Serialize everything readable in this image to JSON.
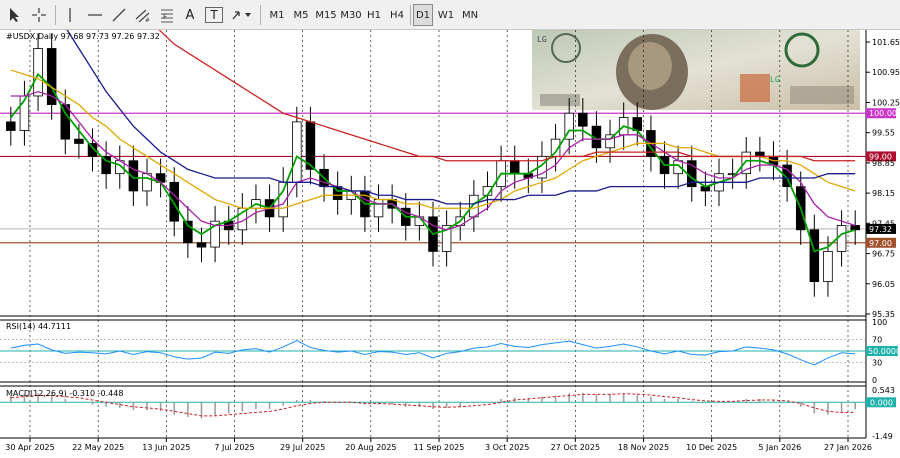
{
  "toolbar": {
    "tools": [
      {
        "name": "cursor-icon"
      },
      {
        "name": "crosshair-icon"
      },
      {
        "name": "vertical-line-icon"
      },
      {
        "name": "horizontal-line-icon"
      },
      {
        "name": "trendline-icon"
      },
      {
        "name": "equidistant-channel-icon"
      },
      {
        "name": "fibonacci-icon"
      },
      {
        "name": "text-icon",
        "label": "A"
      },
      {
        "name": "text-label-icon",
        "label": "T"
      },
      {
        "name": "arrows-icon"
      }
    ],
    "timeframes": [
      "M1",
      "M5",
      "M15",
      "M30",
      "H1",
      "H4",
      "D1",
      "W1",
      "MN"
    ],
    "active_timeframe": "D1"
  },
  "main_panel": {
    "header": "#USDX,Daily  97.68 97.73 97.26 97.32",
    "price_labels": [
      "101.65",
      "100.95",
      "100.25",
      "99.55",
      "98.85",
      "98.15",
      "97.45",
      "96.75",
      "96.05",
      "95.35"
    ],
    "hlines": [
      {
        "value": "100.00",
        "color": "#cc33cc"
      },
      {
        "value": "99.00",
        "color": "#b01030"
      },
      {
        "value": "97.00",
        "color": "#a0522d"
      }
    ],
    "current_price": "97.32"
  },
  "rsi_panel": {
    "header": "RSI(14) 44.7111",
    "levels": [
      "100",
      "70",
      "50",
      "30",
      "0"
    ],
    "level_badge": "50.0000"
  },
  "macd_panel": {
    "header": "MACD(12,26,9) -0.310 -0.448",
    "levels": [
      "0.543",
      "-1.49"
    ],
    "level_badge": "0.000"
  },
  "chart_data": {
    "type": "line",
    "title": "#USDX,Daily",
    "ohlc_last": {
      "open": 97.68,
      "high": 97.73,
      "low": 97.26,
      "close": 97.32
    },
    "x_labels": [
      "30 Apr 2025",
      "22 May 2025",
      "13 Jun 2025",
      "7 Jul 2025",
      "29 Jul 2025",
      "20 Aug 2025",
      "11 Sep 2025",
      "3 Oct 2025",
      "27 Oct 2025",
      "18 Nov 2025",
      "10 Dec 2025",
      "5 Jan 2026",
      "27 Jan 2026"
    ],
    "ylim": [
      95.35,
      101.65
    ],
    "series": [
      {
        "name": "close",
        "color": "#000000",
        "values": [
          99.6,
          100.4,
          101.5,
          100.2,
          99.4,
          99.3,
          99.0,
          98.6,
          98.9,
          98.2,
          98.6,
          98.4,
          97.5,
          97.0,
          96.9,
          97.5,
          97.3,
          97.8,
          98.0,
          97.6,
          98.4,
          99.8,
          98.7,
          98.3,
          98.0,
          98.2,
          97.6,
          98.0,
          97.8,
          97.4,
          97.6,
          96.8,
          97.4,
          97.6,
          98.1,
          98.3,
          98.9,
          98.6,
          98.5,
          99.0,
          99.4,
          100.0,
          99.7,
          99.2,
          99.5,
          99.9,
          99.6,
          99.0,
          98.6,
          98.9,
          98.3,
          98.2,
          98.6,
          98.6,
          99.1,
          99.0,
          98.8,
          98.3,
          97.3,
          96.1,
          96.8,
          97.4,
          97.3
        ]
      },
      {
        "name": "ma-fast",
        "color": "#00a000",
        "values": [
          99.9,
          100.3,
          100.9,
          100.6,
          100.0,
          99.6,
          99.2,
          98.9,
          98.8,
          98.5,
          98.5,
          98.4,
          97.9,
          97.4,
          97.2,
          97.4,
          97.5,
          97.7,
          97.9,
          97.8,
          98.2,
          99.0,
          98.8,
          98.5,
          98.2,
          98.2,
          97.9,
          97.9,
          97.9,
          97.6,
          97.6,
          97.2,
          97.3,
          97.5,
          97.9,
          98.1,
          98.6,
          98.6,
          98.6,
          98.8,
          99.1,
          99.6,
          99.6,
          99.4,
          99.4,
          99.7,
          99.6,
          99.2,
          98.8,
          98.8,
          98.5,
          98.3,
          98.4,
          98.5,
          98.9,
          98.9,
          98.8,
          98.5,
          97.8,
          96.8,
          96.9,
          97.2,
          97.3
        ]
      },
      {
        "name": "ma-mid",
        "color": "#aa22aa",
        "values": [
          100.4,
          100.4,
          100.5,
          100.4,
          100.2,
          99.8,
          99.4,
          99.1,
          98.9,
          98.7,
          98.6,
          98.4,
          98.1,
          97.8,
          97.5,
          97.4,
          97.4,
          97.5,
          97.7,
          97.8,
          97.9,
          98.4,
          98.5,
          98.4,
          98.3,
          98.2,
          98.0,
          97.9,
          97.9,
          97.7,
          97.6,
          97.4,
          97.3,
          97.4,
          97.6,
          97.8,
          98.2,
          98.4,
          98.5,
          98.6,
          98.8,
          99.2,
          99.4,
          99.4,
          99.4,
          99.5,
          99.5,
          99.3,
          99.1,
          98.9,
          98.8,
          98.6,
          98.5,
          98.5,
          98.7,
          98.8,
          98.8,
          98.7,
          98.4,
          97.9,
          97.6,
          97.5,
          97.4
        ]
      },
      {
        "name": "ma-slow",
        "color": "#e0a800",
        "values": [
          101.0,
          100.9,
          100.8,
          100.6,
          100.4,
          100.2,
          99.9,
          99.7,
          99.4,
          99.2,
          99.0,
          98.8,
          98.6,
          98.4,
          98.2,
          98.0,
          97.9,
          97.8,
          97.8,
          97.8,
          97.8,
          97.9,
          98.0,
          98.1,
          98.1,
          98.1,
          98.1,
          98.0,
          98.0,
          97.9,
          97.9,
          97.8,
          97.8,
          97.8,
          97.8,
          97.9,
          98.0,
          98.2,
          98.3,
          98.4,
          98.5,
          98.7,
          98.9,
          99.0,
          99.1,
          99.2,
          99.3,
          99.3,
          99.3,
          99.2,
          99.2,
          99.1,
          99.0,
          99.0,
          99.0,
          99.0,
          98.9,
          98.9,
          98.8,
          98.6,
          98.4,
          98.3,
          98.2
        ]
      },
      {
        "name": "ma-200",
        "color": "#1a1a8c",
        "values": [
          104.0,
          103.5,
          103.0,
          102.5,
          102.0,
          101.5,
          101.0,
          100.5,
          100.1,
          99.7,
          99.4,
          99.1,
          98.9,
          98.7,
          98.6,
          98.5,
          98.5,
          98.5,
          98.5,
          98.5,
          98.4,
          98.4,
          98.4,
          98.3,
          98.3,
          98.2,
          98.2,
          98.1,
          98.1,
          98.0,
          98.0,
          98.0,
          97.9,
          97.9,
          97.9,
          98.0,
          98.0,
          98.0,
          98.1,
          98.1,
          98.1,
          98.2,
          98.2,
          98.2,
          98.3,
          98.3,
          98.3,
          98.3,
          98.3,
          98.3,
          98.4,
          98.4,
          98.4,
          98.4,
          98.4,
          98.5,
          98.5,
          98.5,
          98.5,
          98.5,
          98.6,
          98.6,
          98.6
        ]
      },
      {
        "name": "ma-long",
        "color": "#cc2222",
        "values": [
          106.0,
          105.6,
          105.2,
          104.8,
          104.4,
          104.0,
          103.6,
          103.2,
          102.8,
          102.5,
          102.2,
          101.9,
          101.6,
          101.4,
          101.2,
          101.0,
          100.8,
          100.6,
          100.4,
          100.2,
          100.0,
          99.9,
          99.8,
          99.7,
          99.6,
          99.5,
          99.4,
          99.3,
          99.2,
          99.1,
          99.0,
          99.0,
          98.9,
          98.9,
          98.9,
          98.9,
          98.9,
          98.9,
          98.9,
          98.9,
          99.0,
          99.0,
          99.0,
          99.1,
          99.1,
          99.1,
          99.1,
          99.1,
          99.1,
          99.1,
          99.0,
          99.0,
          99.0,
          99.0,
          99.0,
          99.0,
          99.0,
          99.0,
          99.0,
          98.9,
          98.9,
          98.9,
          98.9
        ]
      }
    ],
    "rsi": [
      55,
      60,
      62,
      52,
      46,
      48,
      47,
      45,
      50,
      44,
      49,
      47,
      40,
      36,
      38,
      48,
      46,
      52,
      54,
      48,
      57,
      68,
      56,
      51,
      48,
      50,
      44,
      49,
      48,
      44,
      47,
      38,
      46,
      49,
      55,
      57,
      63,
      58,
      56,
      61,
      64,
      67,
      61,
      55,
      58,
      62,
      57,
      50,
      45,
      50,
      44,
      43,
      49,
      50,
      57,
      55,
      52,
      45,
      35,
      26,
      38,
      47,
      45
    ],
    "macd": [
      0.3,
      0.35,
      0.4,
      0.3,
      0.15,
      0.0,
      -0.1,
      -0.2,
      -0.25,
      -0.35,
      -0.35,
      -0.4,
      -0.55,
      -0.65,
      -0.7,
      -0.6,
      -0.5,
      -0.4,
      -0.3,
      -0.3,
      -0.15,
      0.1,
      0.1,
      0.05,
      0.0,
      0.0,
      -0.1,
      -0.1,
      -0.1,
      -0.2,
      -0.2,
      -0.3,
      -0.25,
      -0.2,
      -0.05,
      0.0,
      0.15,
      0.2,
      0.2,
      0.25,
      0.3,
      0.4,
      0.4,
      0.35,
      0.35,
      0.4,
      0.35,
      0.25,
      0.15,
      0.15,
      0.05,
      0.0,
      0.05,
      0.05,
      0.15,
      0.15,
      0.1,
      0.0,
      -0.2,
      -0.5,
      -0.55,
      -0.45,
      -0.31
    ],
    "macd_signal": [
      0.2,
      0.25,
      0.3,
      0.3,
      0.25,
      0.2,
      0.1,
      0.0,
      -0.1,
      -0.2,
      -0.25,
      -0.3,
      -0.4,
      -0.5,
      -0.6,
      -0.6,
      -0.55,
      -0.5,
      -0.45,
      -0.4,
      -0.3,
      -0.15,
      -0.05,
      0.0,
      0.0,
      0.0,
      -0.05,
      -0.05,
      -0.08,
      -0.12,
      -0.15,
      -0.2,
      -0.22,
      -0.2,
      -0.15,
      -0.1,
      0.0,
      0.1,
      0.15,
      0.2,
      0.25,
      0.3,
      0.35,
      0.35,
      0.35,
      0.38,
      0.36,
      0.32,
      0.25,
      0.2,
      0.12,
      0.06,
      0.04,
      0.04,
      0.08,
      0.1,
      0.1,
      0.06,
      -0.05,
      -0.25,
      -0.4,
      -0.45,
      -0.448
    ]
  }
}
